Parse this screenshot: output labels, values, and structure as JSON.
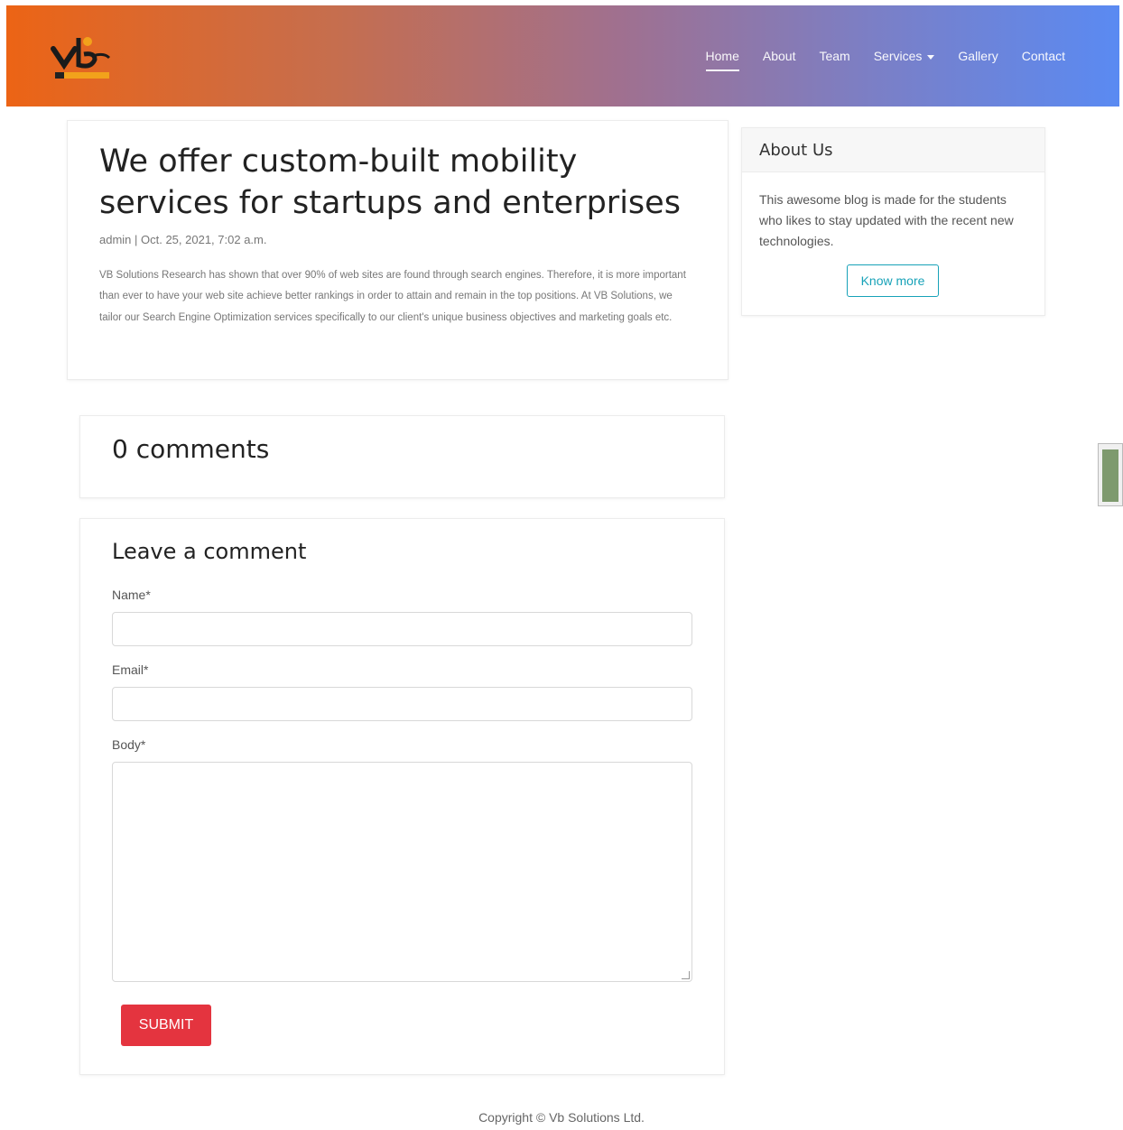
{
  "nav": {
    "links": [
      {
        "label": "Home",
        "active": true
      },
      {
        "label": "About"
      },
      {
        "label": "Team"
      },
      {
        "label": "Services",
        "dropdown": true
      },
      {
        "label": "Gallery"
      },
      {
        "label": "Contact"
      }
    ],
    "gradient_colors": [
      "#ec6415",
      "#5a8af2"
    ]
  },
  "post": {
    "title": "We offer custom-built mobility services for startups and enterprises",
    "meta": "admin | Oct. 25, 2021, 7:02 a.m.",
    "body": "VB Solutions Research has shown that over 90% of web sites are found through search engines. Therefore, it is more important than ever to have your web site achieve better rankings in order to attain and remain in the top positions. At VB Solutions, we tailor our Search Engine Optimization services specifically to our client's unique business objectives and marketing goals etc."
  },
  "about": {
    "title": "About Us",
    "text": "This awesome blog is made for the students who likes to stay updated with the recent new technologies.",
    "button_label": "Know more",
    "accent": "#17a2b8"
  },
  "comments": {
    "count_label": "0 comments"
  },
  "comment_form": {
    "title": "Leave a comment",
    "name_label": "Name*",
    "email_label": "Email*",
    "body_label": "Body*",
    "name_value": "",
    "email_value": "",
    "body_value": "",
    "submit_label": "SUBMIT",
    "submit_color": "#e4343f"
  },
  "footer": {
    "copyright": "Copyright © Vb Solutions Ltd."
  }
}
